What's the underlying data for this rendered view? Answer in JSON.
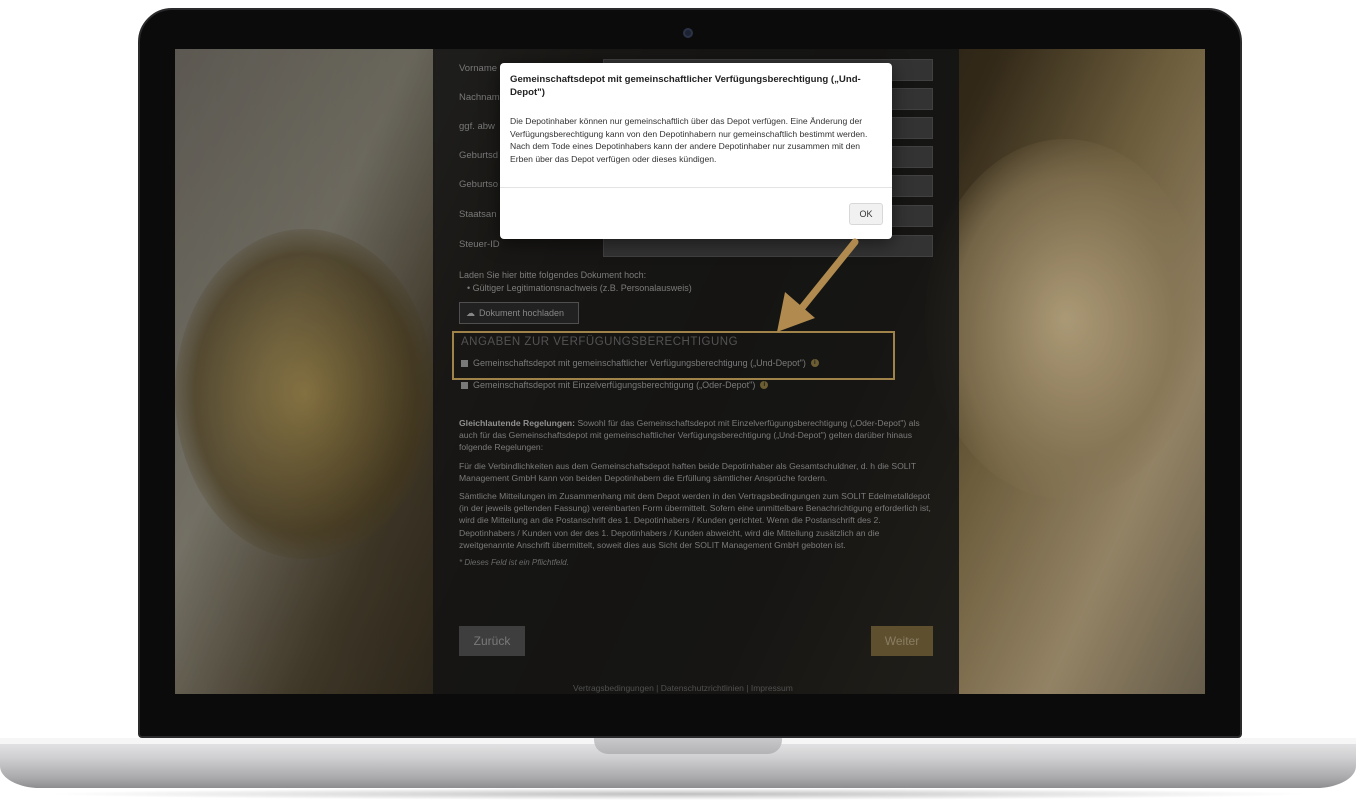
{
  "form": {
    "labels": [
      "Vorname",
      "Nachname",
      "ggf. abw",
      "Geburtsd",
      "Geburtso",
      "Staatsan",
      "Steuer-ID"
    ],
    "upload_intro": "Laden Sie hier bitte folgendes Dokument hoch:",
    "upload_item": "Gültiger Legitimationsnachweis (z.B. Personalausweis)",
    "upload_button": "Dokument hochladen",
    "section_title": "ANGABEN ZUR VERFÜGUNGSBERECHTIGUNG",
    "options": [
      "Gemeinschaftsdepot mit gemeinschaftlicher Verfügungsberechtigung („Und-Depot\")",
      "Gemeinschaftsdepot mit Einzelverfügungsberechtigung („Oder-Depot\")"
    ],
    "rules_heading": "Gleichlautende Regelungen:",
    "rules_text": "Sowohl für das Gemeinschaftsdepot mit Einzelverfügungsberechtigung („Oder-Depot\") als auch für das Gemeinschaftsdepot mit gemeinschaftlicher Verfügungsberechtigung („Und-Depot\") gelten darüber hinaus folgende Regelungen:",
    "para2": "Für die Verbindlichkeiten aus dem Gemeinschaftsdepot haften beide Depotinhaber als Gesamtschuldner, d. h die SOLIT Management GmbH kann von beiden Depotinhabern die Erfüllung sämtlicher Ansprüche fordern.",
    "para3": "Sämtliche Mitteilungen im Zusammenhang mit dem Depot werden in den Vertragsbedingungen zum SOLIT Edelmetalldepot (in der jeweils geltenden Fassung) vereinbarten Form übermittelt. Sofern eine unmittelbare Benachrichtigung erforderlich ist, wird die Mitteilung an die Postanschrift des 1. Depotinhabers / Kunden gerichtet. Wenn die Postanschrift des 2. Depotinhabers / Kunden von der des 1. Depotinhabers / Kunden abweicht, wird die Mitteilung zusätzlich an die zweitgenannte Anschrift übermittelt, soweit dies aus Sicht der SOLIT Management GmbH geboten ist.",
    "required_note": "* Dieses Feld ist ein Pflichtfeld.",
    "back_button": "Zurück",
    "next_button": "Weiter",
    "footer": "Vertragsbedingungen  |  Datenschutzrichtlinien  |  Impressum"
  },
  "modal": {
    "title": "Gemeinschaftsdepot mit gemeinschaftlicher Verfügungsberechtigung („Und-Depot\")",
    "body": "Die Depotinhaber können nur gemeinschaftlich über das Depot verfügen. Eine Änderung der Verfügungsberechtigung kann von den Depotinhabern nur gemeinschaftlich bestimmt werden. Nach dem Tode eines Depotinhabers kann der andere Depotinhaber nur zusammen mit den Erben über das Depot verfügen oder dieses kündigen.",
    "ok_button": "OK"
  },
  "colors": {
    "accent": "#b59654",
    "arrow": "#b08a4e"
  }
}
